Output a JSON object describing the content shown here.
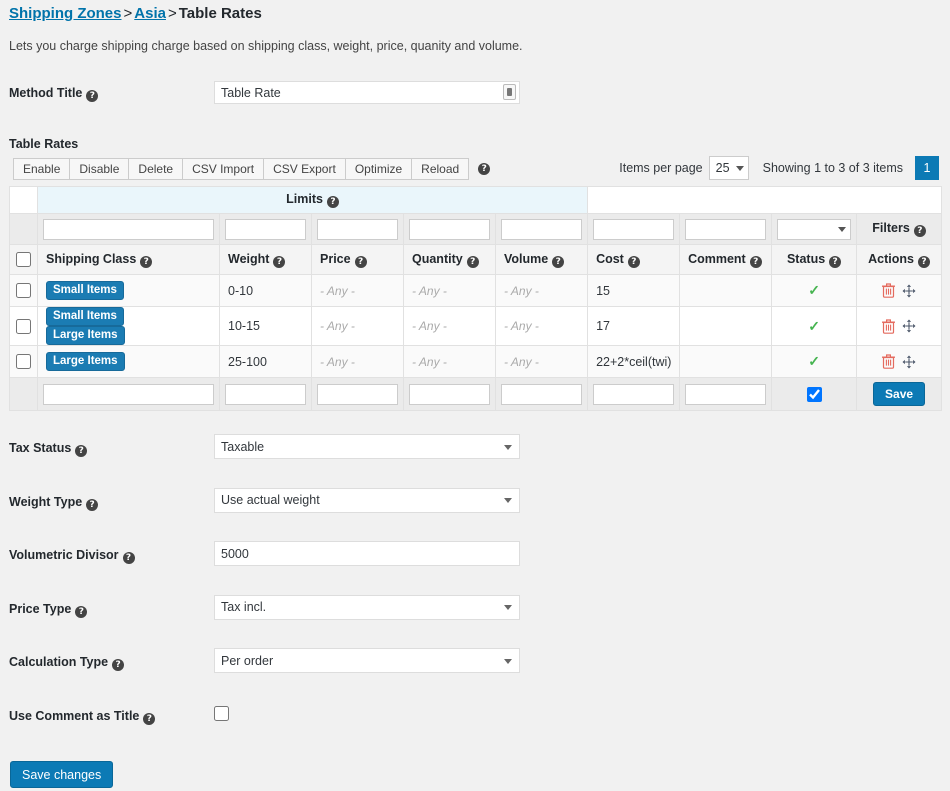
{
  "breadcrumb": {
    "root": "Shipping Zones",
    "zone": "Asia",
    "current": "Table Rates",
    "separator": ">"
  },
  "intro": "Lets you charge shipping charge based on shipping class, weight, price, quanity and volume.",
  "help_glyph": "?",
  "method_title": {
    "label": "Method Title",
    "value": "Table Rate",
    "placeholder": ""
  },
  "table_rates": {
    "heading": "Table Rates",
    "toolbar": {
      "buttons": [
        {
          "label": "Enable"
        },
        {
          "label": "Disable"
        },
        {
          "label": "Delete"
        },
        {
          "label": "CSV Import"
        },
        {
          "label": "CSV Export"
        },
        {
          "label": "Optimize"
        },
        {
          "label": "Reload"
        }
      ]
    },
    "pager": {
      "items_per_page_label": "Items per page",
      "items_per_page_value": "25",
      "showing": "Showing 1 to 3 of 3 items",
      "current_page": "1"
    },
    "limits_group_label": "Limits",
    "filters_label": "Filters",
    "columns": [
      {
        "key": "shipping_class",
        "label": "Shipping Class"
      },
      {
        "key": "weight",
        "label": "Weight"
      },
      {
        "key": "price",
        "label": "Price"
      },
      {
        "key": "quantity",
        "label": "Quantity"
      },
      {
        "key": "volume",
        "label": "Volume"
      },
      {
        "key": "cost",
        "label": "Cost"
      },
      {
        "key": "comment",
        "label": "Comment"
      },
      {
        "key": "status",
        "label": "Status"
      },
      {
        "key": "actions",
        "label": "Actions"
      }
    ],
    "rows": [
      {
        "selected": false,
        "shipping_classes": [
          "Small Items"
        ],
        "weight": "0-10",
        "price": "- Any -",
        "quantity": "- Any -",
        "volume": "- Any -",
        "cost": "15",
        "comment": "",
        "status_enabled": true
      },
      {
        "selected": false,
        "shipping_classes": [
          "Small Items",
          "Large Items"
        ],
        "weight": "10-15",
        "price": "- Any -",
        "quantity": "- Any -",
        "volume": "- Any -",
        "cost": "17",
        "comment": "",
        "status_enabled": true
      },
      {
        "selected": false,
        "shipping_classes": [
          "Large Items"
        ],
        "weight": "25-100",
        "price": "- Any -",
        "quantity": "- Any -",
        "volume": "- Any -",
        "cost": "22+2*ceil(twi)",
        "comment": "",
        "status_enabled": true
      }
    ],
    "new_row": {
      "shipping_class": "",
      "weight": "",
      "price": "",
      "quantity": "",
      "volume": "",
      "cost": "",
      "comment": "",
      "status_checked": true,
      "save_label": "Save"
    },
    "filter_values": {
      "shipping_class": "",
      "weight": "",
      "price": "",
      "quantity": "",
      "volume": "",
      "cost": "",
      "comment": "",
      "status": ""
    }
  },
  "settings": {
    "tax_status": {
      "label": "Tax Status",
      "value": "Taxable"
    },
    "weight_type": {
      "label": "Weight Type",
      "value": "Use actual weight"
    },
    "volumetric_divisor": {
      "label": "Volumetric Divisor",
      "value": "5000"
    },
    "price_type": {
      "label": "Price Type",
      "value": "Tax incl."
    },
    "calculation_type": {
      "label": "Calculation Type",
      "value": "Per order"
    },
    "use_comment_as_title": {
      "label": "Use Comment as Title",
      "checked": false
    }
  },
  "save_changes_label": "Save changes",
  "colors": {
    "page_bg": "#f1f1f1",
    "link": "#0073aa",
    "accent": "#0c7ab5",
    "badge": "#1b7cb3",
    "limits_bg": "#eaf6fb",
    "status_ok": "#46b450",
    "trash": "#e46a5e"
  }
}
